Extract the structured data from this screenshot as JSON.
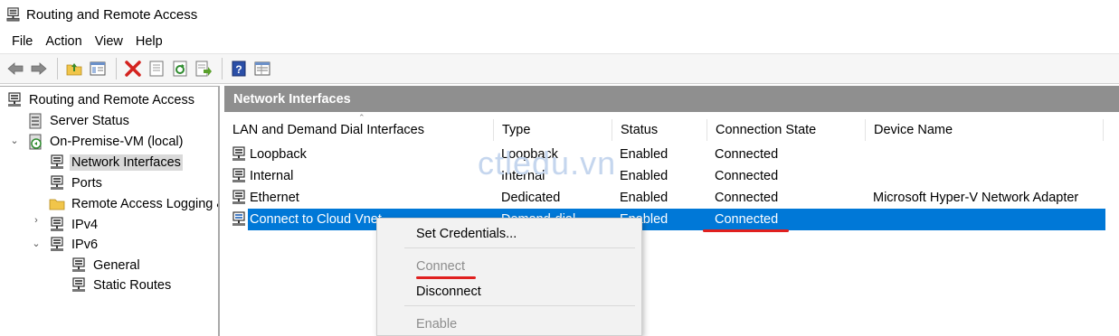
{
  "window": {
    "title": "Routing and Remote Access"
  },
  "menu": [
    "File",
    "Action",
    "View",
    "Help"
  ],
  "toolbar": {
    "icons": [
      "back-arrow-icon",
      "forward-arrow-icon",
      "up-folder-icon",
      "show-hide-tree-icon",
      "delete-icon",
      "properties-icon",
      "refresh-icon",
      "export-list-icon",
      "help-icon",
      "console-view-icon"
    ]
  },
  "tree": {
    "root": "Routing and Remote Access",
    "server_status": "Server Status",
    "server": "On-Premise-VM (local)",
    "network_interfaces": "Network Interfaces",
    "ports": "Ports",
    "remote_access_logging": "Remote Access Logging &",
    "ipv4": "IPv4",
    "ipv6": "IPv6",
    "general": "General",
    "static_routes": "Static Routes"
  },
  "main": {
    "header": "Network Interfaces",
    "columns": [
      "LAN and Demand Dial Interfaces",
      "Type",
      "Status",
      "Connection State",
      "Device Name"
    ],
    "rows": [
      {
        "name": "Loopback",
        "type": "Loopback",
        "status": "Enabled",
        "state": "Connected",
        "device": ""
      },
      {
        "name": "Internal",
        "type": "Internal",
        "status": "Enabled",
        "state": "Connected",
        "device": ""
      },
      {
        "name": "Ethernet",
        "type": "Dedicated",
        "status": "Enabled",
        "state": "Connected",
        "device": "Microsoft Hyper-V Network Adapter"
      },
      {
        "name": "Connect to Cloud Vnet",
        "type": "Demand-dial",
        "status": "Enabled",
        "state": "Connected",
        "device": ""
      }
    ]
  },
  "watermark": "ctledu.vn",
  "context_menu": {
    "items": [
      {
        "label": "Set Credentials...",
        "enabled": true
      },
      {
        "label": "Connect",
        "enabled": false
      },
      {
        "label": "Disconnect",
        "enabled": true
      },
      {
        "label": "Enable",
        "enabled": false
      }
    ]
  },
  "colors": {
    "selection": "#0078d7",
    "header_bar": "#8f8f8f",
    "annotation": "#e0201f"
  }
}
